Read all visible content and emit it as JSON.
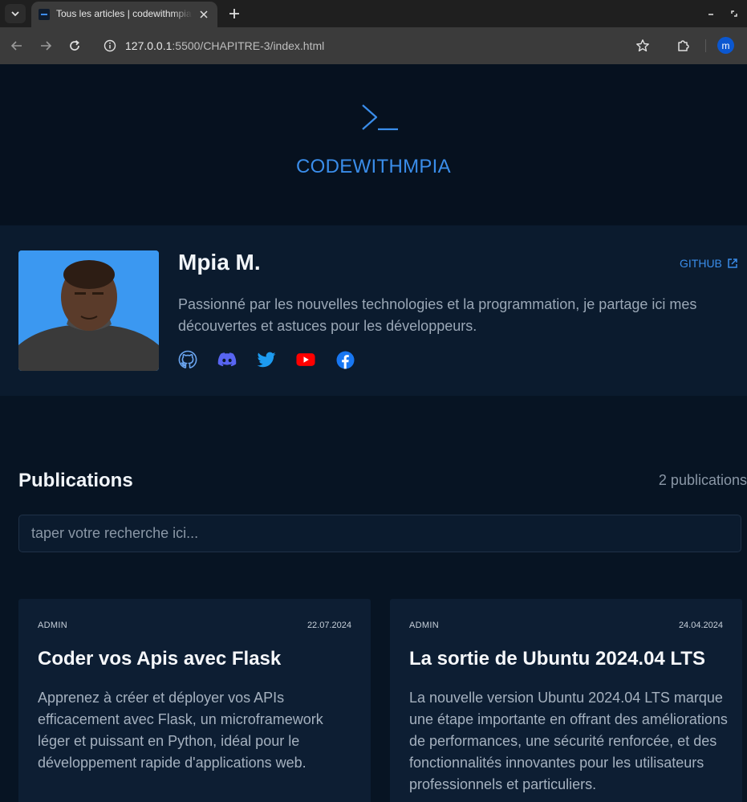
{
  "browser": {
    "tab_title": "Tous les articles | codewithmpia",
    "url_host": "127.0.0.1",
    "url_path": ":5500/CHAPITRE-3/index.html",
    "profile_initial": "m"
  },
  "site": {
    "name": "CODEWITHMPIA"
  },
  "author": {
    "name": "Mpia M.",
    "github_label": "GITHUB",
    "bio": "Passionné par les nouvelles technologies et la programmation, je partage ici mes découvertes et astuces pour les développeurs.",
    "socials": [
      {
        "name": "github",
        "color": "#6aa5f0"
      },
      {
        "name": "discord",
        "color": "#5865f2"
      },
      {
        "name": "twitter",
        "color": "#1d9bf0"
      },
      {
        "name": "youtube",
        "color": "#ff0000"
      },
      {
        "name": "facebook",
        "color": "#1877f2"
      }
    ]
  },
  "publications": {
    "title": "Publications",
    "count_label": "2 publications",
    "search_placeholder": "taper votre recherche ici..."
  },
  "articles": [
    {
      "author": "ADMIN",
      "date": "22.07.2024",
      "title": "Coder vos Apis avec Flask",
      "excerpt": "Apprenez à créer et déployer vos APIs efficacement avec Flask, un microframework léger et puissant en Python, idéal pour le développement rapide d'applications web."
    },
    {
      "author": "ADMIN",
      "date": "24.04.2024",
      "title": "La sortie de Ubuntu 2024.04 LTS",
      "excerpt": "La nouvelle version Ubuntu 2024.04 LTS marque une étape importante en offrant des améliorations de performances, une sécurité renforcée, et des fonctionnalités innovantes pour les utilisateurs professionnels et particuliers."
    }
  ],
  "colors": {
    "accent": "#3a8dea",
    "page_bg": "#071423",
    "card_bg": "#0d1e33"
  }
}
